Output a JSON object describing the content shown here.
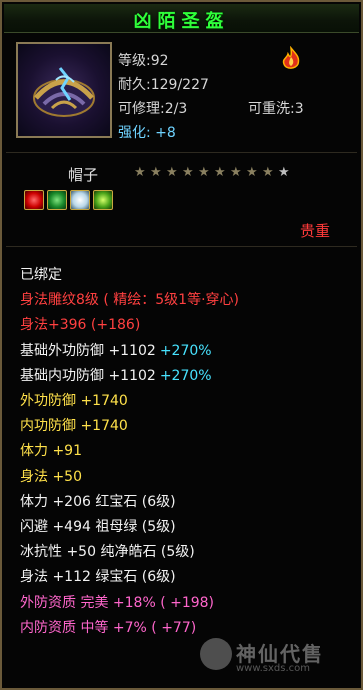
{
  "title": "凶陌圣盔",
  "stats": {
    "level_label": "等级",
    "level_value": ":92",
    "durability_label": "耐久",
    "durability_value": ":129/227",
    "repair_label": "可修理",
    "repair_value": ":2/3",
    "rewash_label": "可重洗",
    "rewash_value": ":3",
    "enhance_label": "强化",
    "enhance_value": ": +8"
  },
  "item_type": "帽子",
  "stars": {
    "filled": 9,
    "total": 10
  },
  "gems": [
    "red-gem-icon",
    "green-gem-icon",
    "white-gem-icon",
    "lime-gem-icon"
  ],
  "precious_label": "贵重",
  "attributes": [
    {
      "text": "已绑定",
      "color": "white"
    },
    {
      "text": "身法雕纹8级 ( 精绘：5级1等·穿心)",
      "color": "red"
    },
    {
      "text": "身法+396 (+186)",
      "color": "red"
    },
    {
      "text": "基础外功防御 +1102",
      "extra": "+270%",
      "color": "white"
    },
    {
      "text": "基础内功防御 +1102",
      "extra": "+270%",
      "color": "white"
    },
    {
      "text": "外功防御 +1740",
      "color": "yellow"
    },
    {
      "text": "内功防御 +1740",
      "color": "yellow"
    },
    {
      "text": "体力 +91",
      "color": "yellow"
    },
    {
      "text": "身法 +50",
      "color": "yellow"
    },
    {
      "text": "体力 +206 红宝石 (6级)",
      "color": "white"
    },
    {
      "text": "闪避 +494 祖母绿 (5级)",
      "color": "white"
    },
    {
      "text": "冰抗性 +50 纯净皓石 (5级)",
      "color": "white"
    },
    {
      "text": "身法 +112 绿宝石 (6级)",
      "color": "white"
    },
    {
      "text": "外防资质  完美 +18% ( +198)",
      "color": "pink"
    },
    {
      "text": "内防资质  中等 +7% ( +77)",
      "color": "pink"
    }
  ],
  "watermark": {
    "text": "神仙代售",
    "url": "www.sxds.com"
  }
}
